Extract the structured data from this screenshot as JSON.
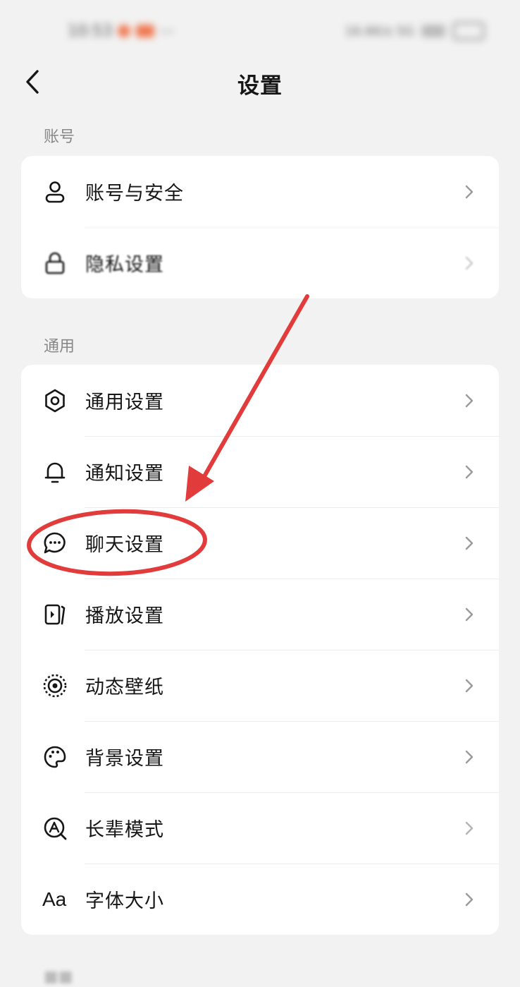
{
  "status": {
    "time": "10:53",
    "network": "16.6K/s 5G"
  },
  "header": {
    "title": "设置"
  },
  "sections": {
    "account": {
      "title": "账号",
      "items": [
        {
          "label": "账号与安全",
          "icon": "person-icon"
        },
        {
          "label": "隐私设置",
          "icon": "lock-icon"
        }
      ]
    },
    "general": {
      "title": "通用",
      "items": [
        {
          "label": "通用设置",
          "icon": "gear-icon"
        },
        {
          "label": "通知设置",
          "icon": "bell-icon"
        },
        {
          "label": "聊天设置",
          "icon": "chat-bubble-icon"
        },
        {
          "label": "播放设置",
          "icon": "play-device-icon"
        },
        {
          "label": "动态壁纸",
          "icon": "dynamic-wallpaper-icon"
        },
        {
          "label": "背景设置",
          "icon": "palette-icon"
        },
        {
          "label": "长辈模式",
          "icon": "elder-mode-icon"
        },
        {
          "label": "字体大小",
          "icon": "font-size-icon",
          "icon_text": "Aa"
        }
      ]
    }
  },
  "annotation": {
    "color": "#e23b3b",
    "highlighted_item": "聊天设置"
  },
  "colors": {
    "background": "#f2f2f2",
    "card": "#ffffff",
    "section_title": "#888888",
    "chevron": "#b3b3b3"
  }
}
